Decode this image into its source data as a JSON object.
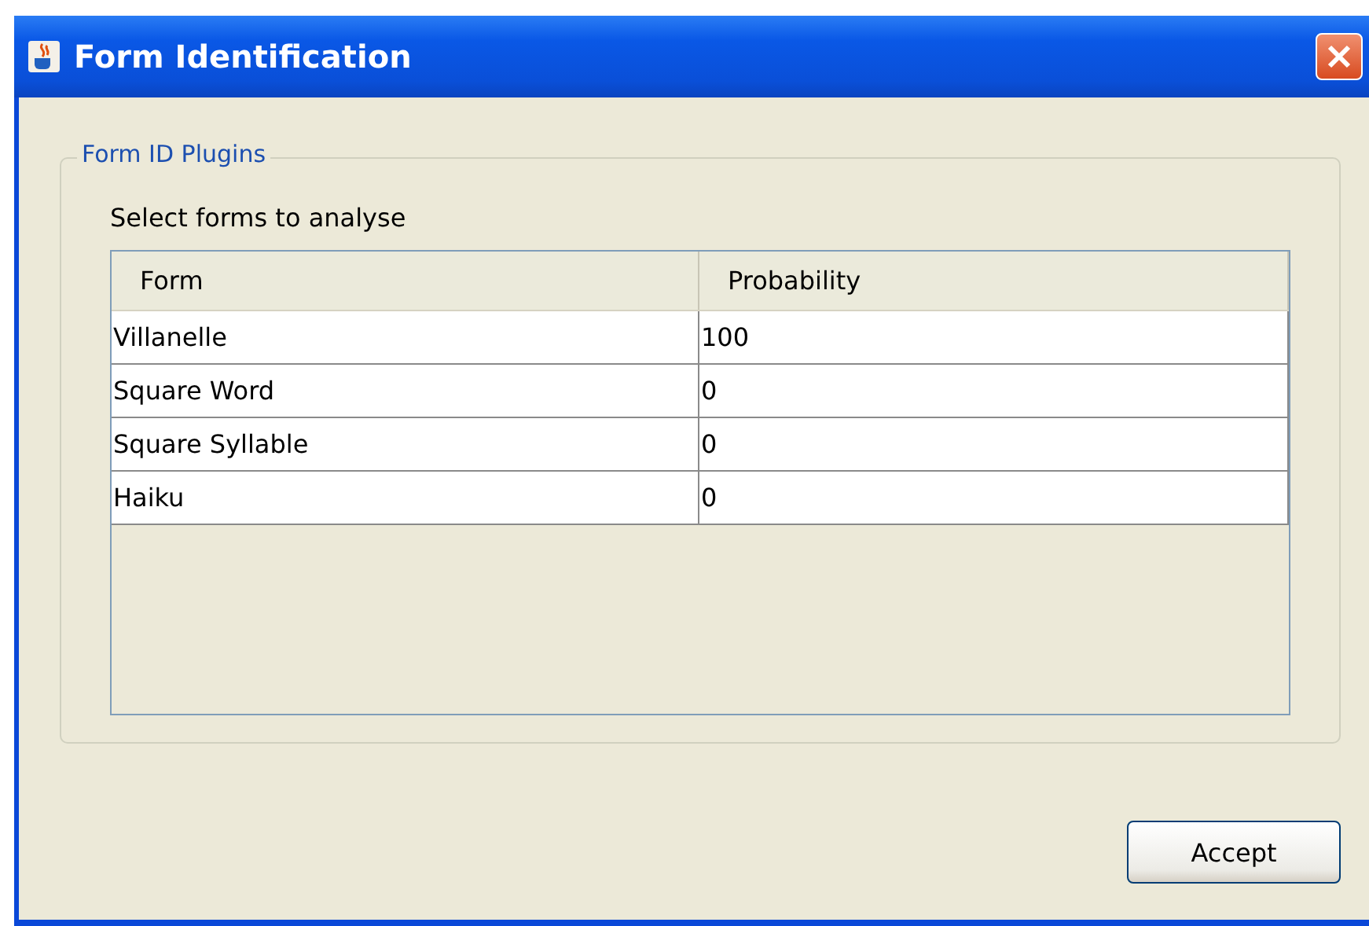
{
  "window": {
    "title": "Form Identification"
  },
  "group": {
    "title": "Form ID Plugins",
    "instruction": "Select forms to analyse"
  },
  "table": {
    "columns": [
      "Form",
      "Probability"
    ],
    "rows": [
      {
        "form": "Villanelle",
        "probability": "100"
      },
      {
        "form": "Square Word",
        "probability": "0"
      },
      {
        "form": "Square Syllable",
        "probability": "0"
      },
      {
        "form": "Haiku",
        "probability": "0"
      }
    ]
  },
  "buttons": [
    "Accept"
  ]
}
